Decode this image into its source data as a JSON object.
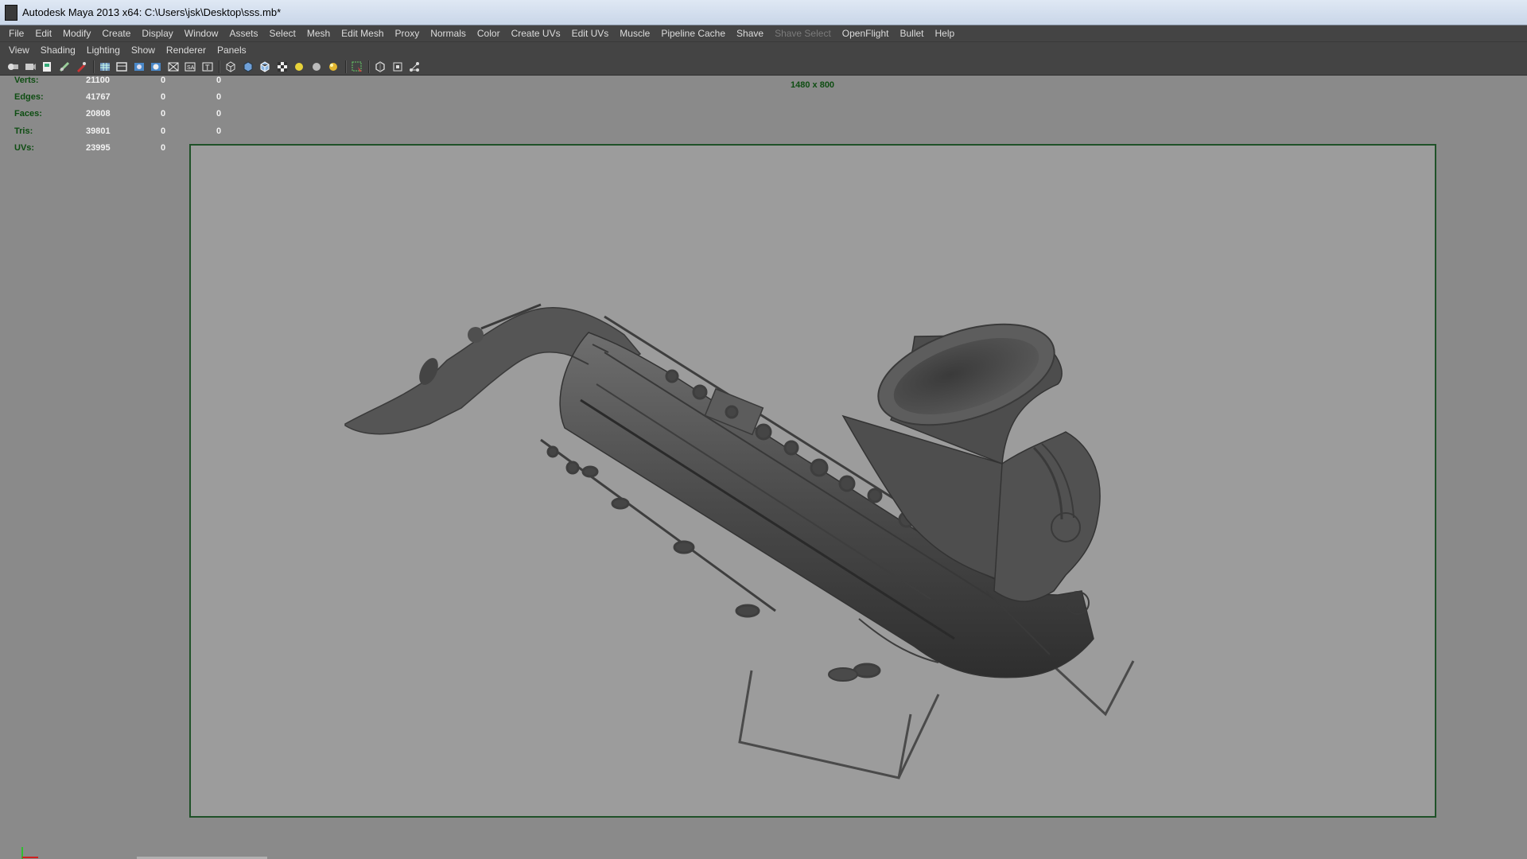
{
  "window": {
    "title": "Autodesk Maya 2013 x64: C:\\Users\\jsk\\Desktop\\sss.mb*"
  },
  "main_menu": [
    {
      "label": "File",
      "enabled": true
    },
    {
      "label": "Edit",
      "enabled": true
    },
    {
      "label": "Modify",
      "enabled": true
    },
    {
      "label": "Create",
      "enabled": true
    },
    {
      "label": "Display",
      "enabled": true
    },
    {
      "label": "Window",
      "enabled": true
    },
    {
      "label": "Assets",
      "enabled": true
    },
    {
      "label": "Select",
      "enabled": true
    },
    {
      "label": "Mesh",
      "enabled": true
    },
    {
      "label": "Edit Mesh",
      "enabled": true
    },
    {
      "label": "Proxy",
      "enabled": true
    },
    {
      "label": "Normals",
      "enabled": true
    },
    {
      "label": "Color",
      "enabled": true
    },
    {
      "label": "Create UVs",
      "enabled": true
    },
    {
      "label": "Edit UVs",
      "enabled": true
    },
    {
      "label": "Muscle",
      "enabled": true
    },
    {
      "label": "Pipeline Cache",
      "enabled": true
    },
    {
      "label": "Shave",
      "enabled": true
    },
    {
      "label": "Shave Select",
      "enabled": false
    },
    {
      "label": "OpenFlight",
      "enabled": true
    },
    {
      "label": "Bullet",
      "enabled": true
    },
    {
      "label": "Help",
      "enabled": true
    }
  ],
  "panel_menu": [
    "View",
    "Shading",
    "Lighting",
    "Show",
    "Renderer",
    "Panels"
  ],
  "toolbar_icons": [
    "camera-attributes-icon",
    "camera-bookmark-icon",
    "image-plane-icon",
    "two-d-pan-zoom-icon",
    "grease-pencil-icon",
    "grid-icon",
    "film-gate-icon",
    "resolution-gate-icon",
    "gate-mask-icon",
    "field-chart-icon",
    "safe-action-icon",
    "safe-title-icon",
    "wireframe-icon",
    "smooth-shade-icon",
    "wireframe-on-shaded-icon",
    "textured-icon",
    "default-lighting-icon",
    "shadows-icon",
    "all-lights-icon",
    "isolate-select-icon",
    "xray-icon",
    "xray-active-components-icon",
    "xray-joints-icon"
  ],
  "heads_up": {
    "resolution": "1480 x 800",
    "stats": [
      {
        "label": "Verts:",
        "v1": "21100",
        "v2": "0",
        "v3": "0"
      },
      {
        "label": "Edges:",
        "v1": "41767",
        "v2": "0",
        "v3": "0"
      },
      {
        "label": "Faces:",
        "v1": "20808",
        "v2": "0",
        "v3": "0"
      },
      {
        "label": "Tris:",
        "v1": "39801",
        "v2": "0",
        "v3": "0"
      },
      {
        "label": "UVs:",
        "v1": "23995",
        "v2": "0",
        "v3": "0"
      }
    ]
  },
  "colors": {
    "ui_dark": "#444444",
    "viewport_bg": "#8a8a8a",
    "gate_bg": "#9c9c9c",
    "hud_label": "#0e4d12",
    "hud_value": "#f2f2f2",
    "gate_border": "#1f5128"
  }
}
